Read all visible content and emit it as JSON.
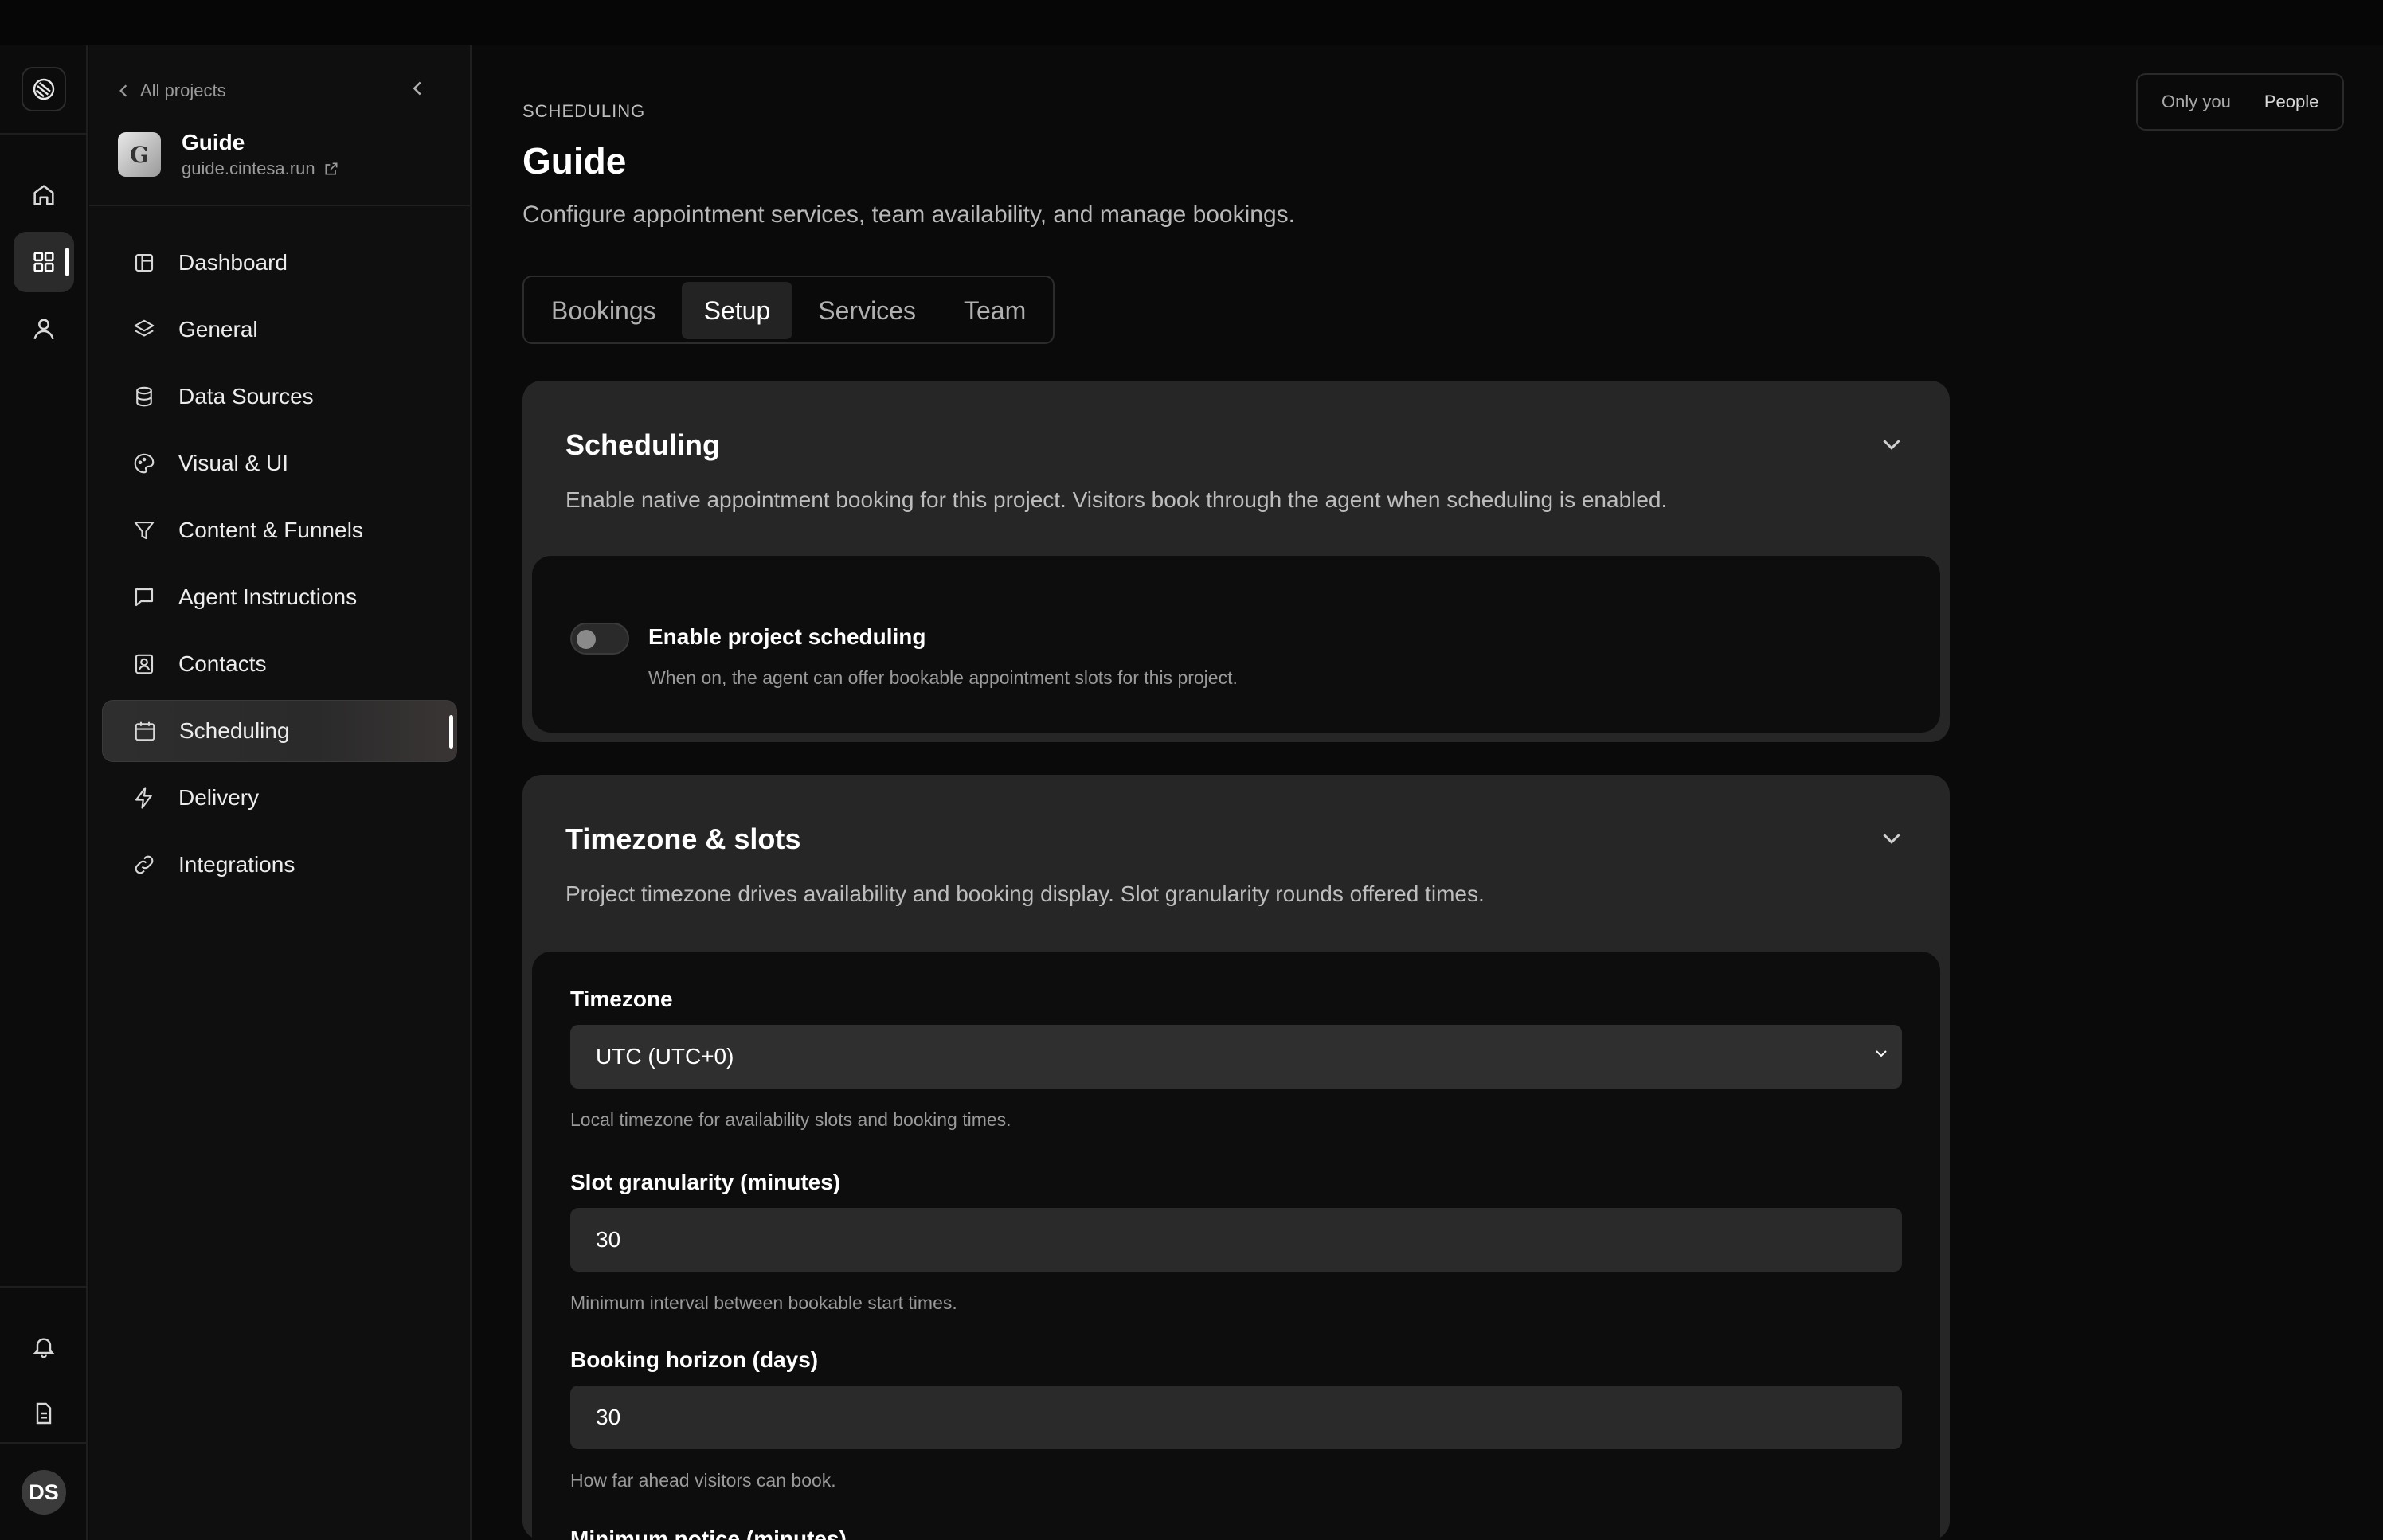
{
  "rail": {
    "avatar_initials": "DS"
  },
  "sidebar": {
    "back_label": "All projects",
    "project": {
      "name": "Guide",
      "url": "guide.cintesa.run",
      "logo_letter": "G"
    },
    "items": [
      {
        "label": "Dashboard",
        "icon": "dashboard-icon"
      },
      {
        "label": "General",
        "icon": "layers-icon"
      },
      {
        "label": "Data Sources",
        "icon": "database-icon"
      },
      {
        "label": "Visual & UI",
        "icon": "palette-icon"
      },
      {
        "label": "Content & Funnels",
        "icon": "funnel-icon"
      },
      {
        "label": "Agent Instructions",
        "icon": "message-icon"
      },
      {
        "label": "Contacts",
        "icon": "contact-icon"
      },
      {
        "label": "Scheduling",
        "icon": "calendar-icon",
        "active": true
      },
      {
        "label": "Delivery",
        "icon": "bolt-icon"
      },
      {
        "label": "Integrations",
        "icon": "link-icon"
      }
    ]
  },
  "header": {
    "eyebrow": "SCHEDULING",
    "title": "Guide",
    "subtitle": "Configure appointment services, team availability, and manage bookings.",
    "view_toggle": [
      "Only you",
      "People"
    ]
  },
  "tabs": [
    {
      "label": "Bookings"
    },
    {
      "label": "Setup",
      "active": true
    },
    {
      "label": "Services"
    },
    {
      "label": "Team"
    }
  ],
  "scheduling_card": {
    "title": "Scheduling",
    "description": "Enable native appointment booking for this project. Visitors book through the agent when scheduling is enabled.",
    "toggle_label": "Enable project scheduling",
    "toggle_help": "When on, the agent can offer bookable appointment slots for this project.",
    "toggle_on": false
  },
  "timezone_card": {
    "title": "Timezone & slots",
    "description": "Project timezone drives availability and booking display. Slot granularity rounds offered times.",
    "timezone": {
      "label": "Timezone",
      "value": "UTC (UTC+0)",
      "help": "Local timezone for availability slots and booking times."
    },
    "slot": {
      "label": "Slot granularity (minutes)",
      "value": "30",
      "help": "Minimum interval between bookable start times."
    },
    "horizon": {
      "label": "Booking horizon (days)",
      "value": "30",
      "help": "How far ahead visitors can book."
    },
    "notice": {
      "label": "Minimum notice (minutes)"
    }
  },
  "colors": {
    "background": "#0a0a0a",
    "card": "#262626",
    "inner": "#0d0d0d",
    "field": "#2a2a2a"
  }
}
